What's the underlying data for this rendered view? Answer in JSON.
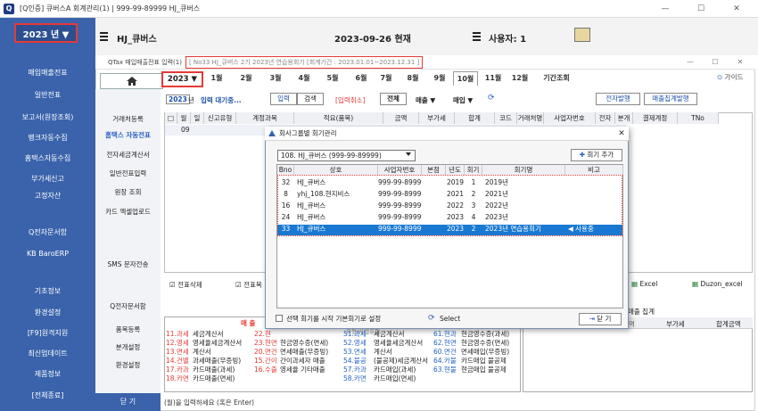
{
  "window": {
    "title": "[Q인증] 큐버스A   회계관리(1) | 999-99-89999  HJ_큐버스",
    "app_icon": "Q",
    "minimize": "—",
    "maximize": "☐",
    "close": "✕"
  },
  "nav": {
    "year": "2023 년 ▼",
    "items": [
      "매입매출전표",
      "일반전표",
      "보고서(원장조회)",
      "뱅크자동수집",
      "홈택스자동수집",
      "부가세신고",
      "고정자산",
      "Q전자문서함",
      "KB BaroERP",
      "기초정보",
      "환경설정",
      "[F9]원격지원",
      "최신업데이트",
      "제품정보",
      "[전체종료]"
    ]
  },
  "header": {
    "company": "HJ_큐버스",
    "date": "2023-09-26 현재",
    "user": "사용자: 1"
  },
  "subwin": {
    "title_prefix": "QTax 매입매출전표 입력(1)",
    "title_info": "[ No33 HJ_큐버스 2기 2023년 연습용회기 [회계기간 : 2023.01.01~2023.12.31 ]",
    "controls": {
      "min": "—",
      "max": "☐",
      "close": "✕"
    },
    "guide": "가이드"
  },
  "subnav": {
    "items": [
      "거래처등록",
      "홈택스 자동전표",
      "전자세금계산서",
      "일반전표입력",
      "원장 조회",
      "카드 엑셀업로드",
      "SMS 문자전송",
      "Q전자문서함",
      "품목등록",
      "분개설정",
      "환경설정"
    ],
    "close": "닫 기"
  },
  "months": {
    "year": "2023 ▼",
    "tabs": [
      "1월",
      "2월",
      "3월",
      "4월",
      "5월",
      "6월",
      "7월",
      "8월",
      "9월",
      "10월",
      "11월",
      "12월",
      "기간조회"
    ],
    "active_index": 9
  },
  "toolbar": {
    "year_box": "2023",
    "year_suffix": "년",
    "waiting": "입력 대기중...",
    "input": "입력",
    "search": "검색",
    "cancel_input": "[입력취소]",
    "all": "전체",
    "sales": "매출",
    "purchase": "매입",
    "e_issue": "전자발행",
    "sales_issue": "매출집계발행"
  },
  "grid": {
    "headers": [
      "□",
      "월",
      "일",
      "신고유형",
      "계정과목",
      "적요(품목)",
      "금액",
      "부가세",
      "합계",
      "코드",
      "거래처명",
      "사업자번호",
      "전자",
      "분개",
      "결제계정",
      "TNo"
    ],
    "row_day": "09"
  },
  "dialog": {
    "title": "회사그룹별 회기관리",
    "company_select": "108. HJ_큐버스 (999-99-89999)",
    "add": "회기 추가",
    "headers": [
      "Bno",
      "상호",
      "사업자번호",
      "본점",
      "년도",
      "회기",
      "회기명",
      "비고"
    ],
    "rows": [
      {
        "bno": "32",
        "name": "HJ_큐버스",
        "biz": "999-99-89999",
        "year": "2019",
        "term": "1",
        "termname": "2019년",
        "note": ""
      },
      {
        "bno": "8",
        "name": "yhj_108.현지비스",
        "biz": "999-99-89999",
        "year": "2021",
        "term": "2",
        "termname": "2021년",
        "note": ""
      },
      {
        "bno": "16",
        "name": "HJ_큐버스",
        "biz": "999-99-89999",
        "year": "2022",
        "term": "3",
        "termname": "2022년",
        "note": ""
      },
      {
        "bno": "24",
        "name": "HJ_큐버스",
        "biz": "999-99-89999",
        "year": "2023",
        "term": "4",
        "termname": "2023년",
        "note": ""
      },
      {
        "bno": "33",
        "name": "HJ_큐버스",
        "biz": "999-99-89999",
        "year": "2023",
        "term": "2",
        "termname": "2023년 연습용회기",
        "note": "◀ 사용중"
      }
    ],
    "checkbox": "선택 회기를 시작 기본회기로 설정",
    "select": "Select",
    "close": "닫 기"
  },
  "bottom": {
    "delete": "전표삭제",
    "slip": "전표복",
    "excel": "Excel",
    "duzon": "Duzon_excel",
    "sales_total": "매출 집계",
    "vat_total": "부가세",
    "sum_total": "합계금액",
    "sales": "매 출",
    "type_label": "유형/사업유형",
    "col1": [
      "11.과세",
      "12.영세",
      "13.면세",
      "14.건별",
      "17.카과",
      "18.카면"
    ],
    "col2": [
      "세금계산서",
      "영세율세금계산서",
      "계산서",
      "과세매출(무증빙)",
      "카드매출(과세)",
      "카드매출(면세)"
    ],
    "col3": [
      "22.현",
      "23.현면",
      "20.면건",
      "15.간이",
      "16.수출"
    ],
    "col4": [
      "",
      "현금영수증(면세)",
      "면세매출(무증빙)",
      "간이과세자 매출",
      "영세율 기타매출"
    ],
    "col5": [
      "51.과세",
      "52.영세",
      "53.면세",
      "54.불공",
      "57.카과",
      "58.카면"
    ],
    "col6": [
      "세금계산서",
      "영세율세금계산서",
      "계산서",
      "(불공제)세금계산서",
      "카드매입(과세)",
      "카드매입(면세)"
    ],
    "col7": [
      "61.현과",
      "62.현면",
      "60.면건",
      "64.카불",
      "63.현불"
    ],
    "col8": [
      "현금영수증(과세)",
      "현금영수증(면세)",
      "면세매입(무증빙)",
      "카드매입 불공제",
      "현금매입 불공제"
    ],
    "status": "(월)을 입력하세요 (혹은 Enter)"
  },
  "colors": {
    "nav": "#3a63ab",
    "highlight": "#1979d2",
    "red": "#e53935"
  }
}
